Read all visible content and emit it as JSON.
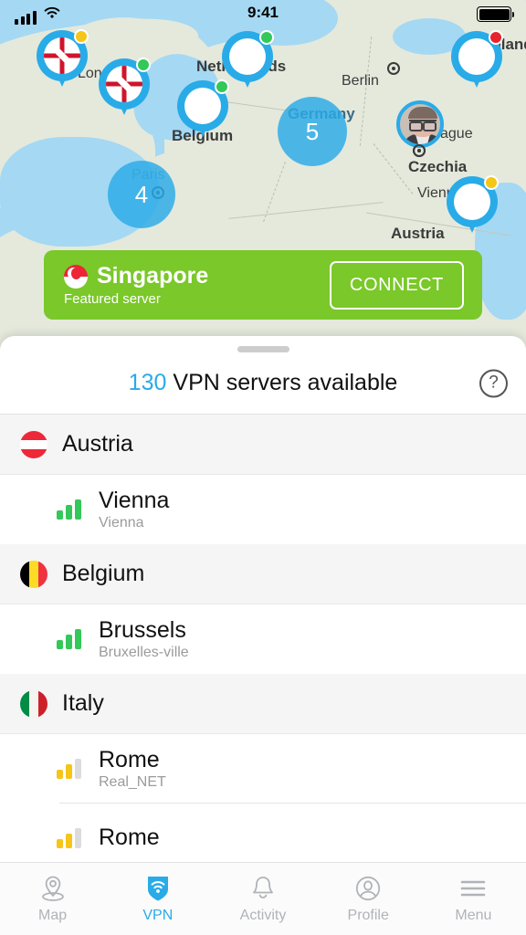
{
  "status_bar": {
    "time": "9:41",
    "signal_icon": "cellular-signal-icon",
    "wifi_icon": "wifi-icon",
    "battery_icon": "battery-full-icon"
  },
  "map": {
    "labels": [
      {
        "text": "London",
        "type": "city"
      },
      {
        "text": "Netherlands",
        "type": "country"
      },
      {
        "text": "Belgium",
        "type": "country"
      },
      {
        "text": "Berlin",
        "type": "city"
      },
      {
        "text": "Poland",
        "type": "country"
      },
      {
        "text": "Germany",
        "type": "country"
      },
      {
        "text": "Prague",
        "type": "city"
      },
      {
        "text": "Czechia",
        "type": "country"
      },
      {
        "text": "Paris",
        "type": "city"
      },
      {
        "text": "Vienna",
        "type": "city"
      },
      {
        "text": "Austria",
        "type": "country"
      }
    ],
    "pins": [
      {
        "country": "United Kingdom",
        "flag": "uk",
        "status": "yellow",
        "status_color": "#F5C518"
      },
      {
        "country": "United Kingdom",
        "flag": "uk",
        "status": "green",
        "status_color": "#34C759"
      },
      {
        "country": "Netherlands",
        "flag": "nl",
        "status": "green",
        "status_color": "#34C759"
      },
      {
        "country": "Belgium",
        "flag": "be",
        "status": "green",
        "status_color": "#34C759"
      },
      {
        "country": "Poland",
        "flag": "pl",
        "status": "red",
        "status_color": "#E8232B"
      },
      {
        "country": "Austria",
        "flag": "at",
        "status": "yellow",
        "status_color": "#F5C518"
      }
    ],
    "clusters": [
      {
        "label": "Paris",
        "count": "4"
      },
      {
        "label": "Germany",
        "count": "5"
      }
    ],
    "user_marker": "user-avatar-marker"
  },
  "featured": {
    "flag": "singapore",
    "title": "Singapore",
    "subtitle": "Featured server",
    "connect_label": "CONNECT",
    "background_color": "#7AC829"
  },
  "sheet": {
    "grabber": "sheet-grabber",
    "count": "130",
    "headline": "VPN servers available",
    "count_color": "#29ABE8",
    "help_label": "?"
  },
  "server_list": [
    {
      "country": "Austria",
      "flag": "at",
      "servers": [
        {
          "name": "Vienna",
          "subtitle": "Vienna",
          "signal": "strong",
          "signal_color": "#34C759",
          "bars_filled": 3
        }
      ]
    },
    {
      "country": "Belgium",
      "flag": "be",
      "servers": [
        {
          "name": "Brussels",
          "subtitle": "Bruxelles-ville",
          "signal": "strong",
          "signal_color": "#34C759",
          "bars_filled": 3
        }
      ]
    },
    {
      "country": "Italy",
      "flag": "it",
      "servers": [
        {
          "name": "Rome",
          "subtitle": "Real_NET",
          "signal": "medium",
          "signal_color": "#F5C518",
          "bars_filled": 2
        },
        {
          "name": "Rome",
          "subtitle": "",
          "signal": "medium",
          "signal_color": "#F5C518",
          "bars_filled": 2
        }
      ]
    }
  ],
  "tabs": [
    {
      "label": "Map",
      "icon": "map-pin-icon",
      "active": false
    },
    {
      "label": "VPN",
      "icon": "shield-wifi-icon",
      "active": true
    },
    {
      "label": "Activity",
      "icon": "bell-icon",
      "active": false
    },
    {
      "label": "Profile",
      "icon": "person-circle-icon",
      "active": false
    },
    {
      "label": "Menu",
      "icon": "hamburger-menu-icon",
      "active": false
    }
  ]
}
